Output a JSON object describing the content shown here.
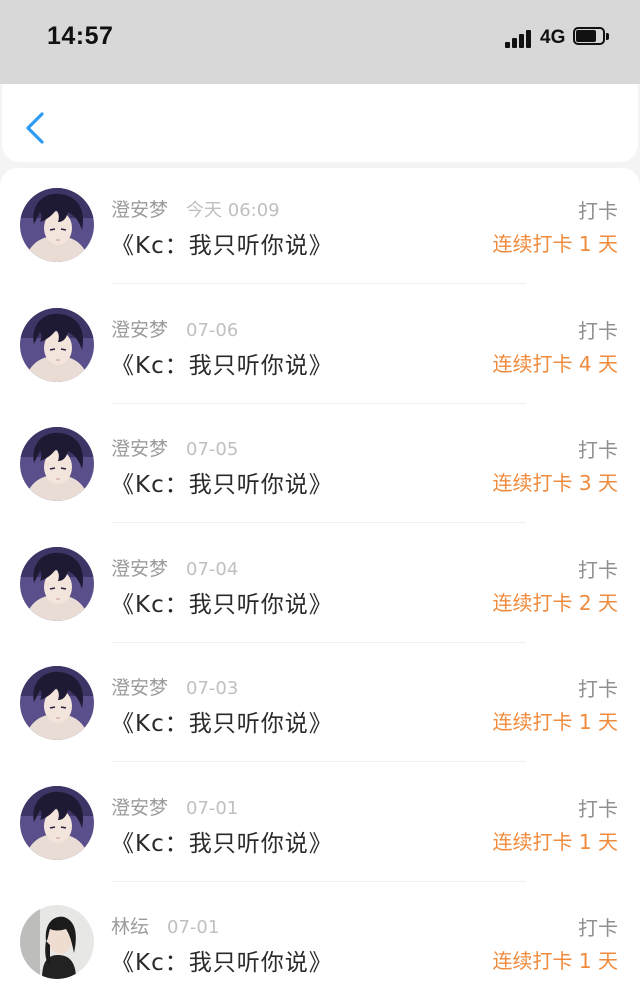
{
  "status_bar": {
    "time": "14:57",
    "network": "4G"
  },
  "nav": {
    "back_icon": "chevron-left-icon",
    "accent_color": "#2b9af3"
  },
  "colors": {
    "streak": "#f08a3c",
    "muted": "#9b9b9b"
  },
  "records": [
    {
      "name": "澄安梦",
      "date": "今天 06:09",
      "title": "《Kc：我只听你说》",
      "type": "打卡",
      "streak": "连续打卡 1 天",
      "avatar": "anime-boy"
    },
    {
      "name": "澄安梦",
      "date": "07-06",
      "title": "《Kc：我只听你说》",
      "type": "打卡",
      "streak": "连续打卡 4 天",
      "avatar": "anime-boy"
    },
    {
      "name": "澄安梦",
      "date": "07-05",
      "title": "《Kc：我只听你说》",
      "type": "打卡",
      "streak": "连续打卡 3 天",
      "avatar": "anime-boy"
    },
    {
      "name": "澄安梦",
      "date": "07-04",
      "title": "《Kc：我只听你说》",
      "type": "打卡",
      "streak": "连续打卡 2 天",
      "avatar": "anime-boy"
    },
    {
      "name": "澄安梦",
      "date": "07-03",
      "title": "《Kc：我只听你说》",
      "type": "打卡",
      "streak": "连续打卡 1 天",
      "avatar": "anime-boy"
    },
    {
      "name": "澄安梦",
      "date": "07-01",
      "title": "《Kc：我只听你说》",
      "type": "打卡",
      "streak": "连续打卡 1 天",
      "avatar": "anime-boy"
    },
    {
      "name": "林纭",
      "date": "07-01",
      "title": "《Kc：我只听你说》",
      "type": "打卡",
      "streak": "连续打卡 1 天",
      "avatar": "girl-photo"
    }
  ]
}
